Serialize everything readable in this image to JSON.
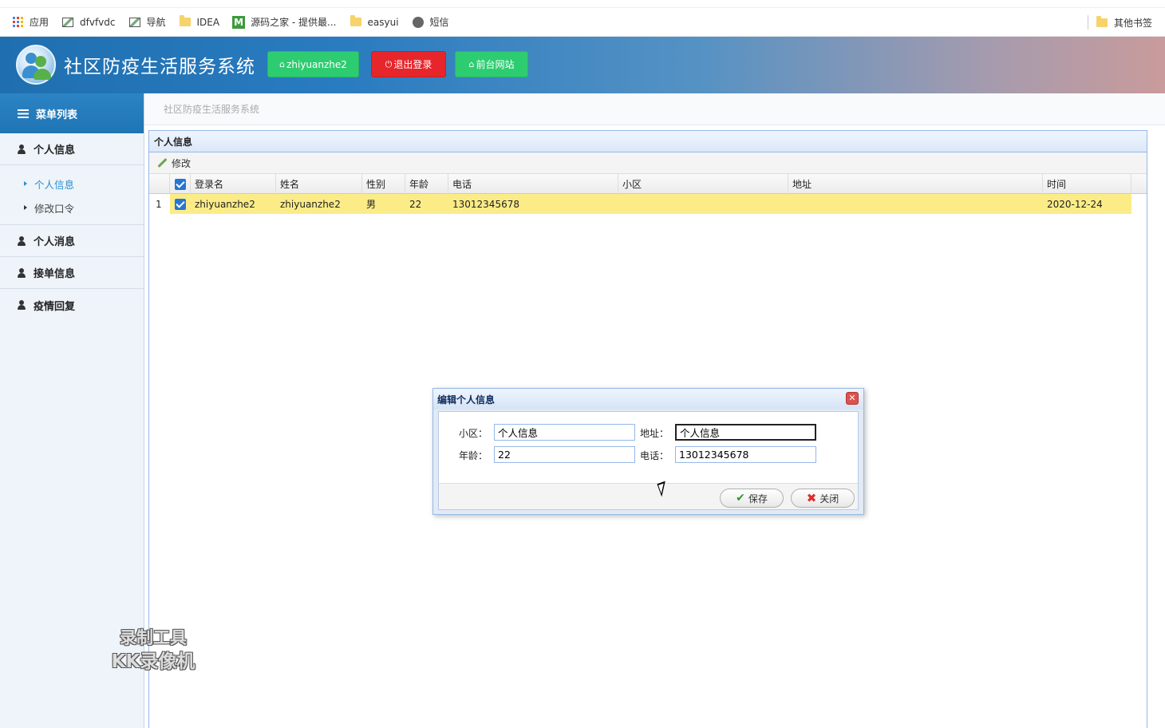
{
  "bookmarks": {
    "items": [
      {
        "label": "应用",
        "icon": "apps-grid-icon"
      },
      {
        "label": "dfvfvdc",
        "icon": "image-icon"
      },
      {
        "label": "导航",
        "icon": "image-icon"
      },
      {
        "label": "IDEA",
        "icon": "folder-icon"
      },
      {
        "label": "源码之家 - 提供最...",
        "icon": "m-site-icon"
      },
      {
        "label": "easyui",
        "icon": "folder-icon"
      },
      {
        "label": "短信",
        "icon": "globe-icon"
      }
    ],
    "other": "其他书签"
  },
  "header": {
    "title": "社区防疫生活服务系统",
    "user_btn": "zhiyuanzhe2",
    "logout_btn": "退出登录",
    "front_btn": "前台网站",
    "colors": {
      "green": "#2ecc71",
      "red": "#e6262b"
    }
  },
  "sidebar": {
    "head": "菜单列表",
    "groups": [
      {
        "label": "个人信息",
        "children": [
          {
            "label": "个人信息",
            "active": true
          },
          {
            "label": "修改口令",
            "active": false
          }
        ]
      },
      {
        "label": "个人消息"
      },
      {
        "label": "接单信息"
      },
      {
        "label": "疫情回复"
      }
    ]
  },
  "breadcrumb": "社区防疫生活服务系统",
  "panel": {
    "title": "个人信息",
    "toolbar_edit": "修改",
    "columns": [
      "登录名",
      "姓名",
      "性别",
      "年龄",
      "电话",
      "小区",
      "地址",
      "时间"
    ],
    "rows": [
      {
        "num": "1",
        "checked": true,
        "cells": [
          "zhiyuanzhe2",
          "zhiyuanzhe2",
          "男",
          "22",
          "13012345678",
          "",
          "",
          "2020-12-24"
        ]
      }
    ]
  },
  "dialog": {
    "title": "编辑个人信息",
    "fields": {
      "community": {
        "label": "小区：",
        "value": "个人信息"
      },
      "address": {
        "label": "地址：",
        "value": "个人信息"
      },
      "age": {
        "label": "年龄：",
        "value": "22"
      },
      "phone": {
        "label": "电话：",
        "value": "13012345678"
      }
    },
    "save": "保存",
    "close": "关闭"
  },
  "watermark": {
    "line1": "录制工具",
    "line2": "KK录像机"
  }
}
